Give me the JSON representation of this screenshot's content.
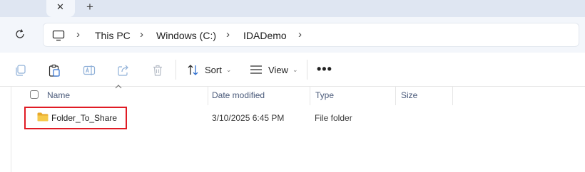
{
  "tabs": {
    "close_symbol": "✕",
    "add_symbol": "+"
  },
  "address_bar": {
    "breadcrumbs": [
      "This PC",
      "Windows (C:)",
      "IDADemo"
    ],
    "separator": "›"
  },
  "toolbar": {
    "sort_label": "Sort",
    "view_label": "View",
    "more_label": "•••",
    "dropdown_symbol": "⌄"
  },
  "columns": {
    "name": "Name",
    "date_modified": "Date modified",
    "type": "Type",
    "size": "Size"
  },
  "files": [
    {
      "name": "Folder_To_Share",
      "date_modified": "3/10/2025 6:45 PM",
      "type": "File folder",
      "size": ""
    }
  ],
  "colors": {
    "highlight": "#e01b24",
    "folder": "#f4c542",
    "tabstrip": "#dfe6f2"
  },
  "icons": [
    "refresh-icon",
    "computer-icon",
    "copy-icon",
    "paste-icon",
    "rename-icon",
    "share-icon",
    "delete-icon",
    "sort-icon",
    "view-icon",
    "folder-icon"
  ]
}
